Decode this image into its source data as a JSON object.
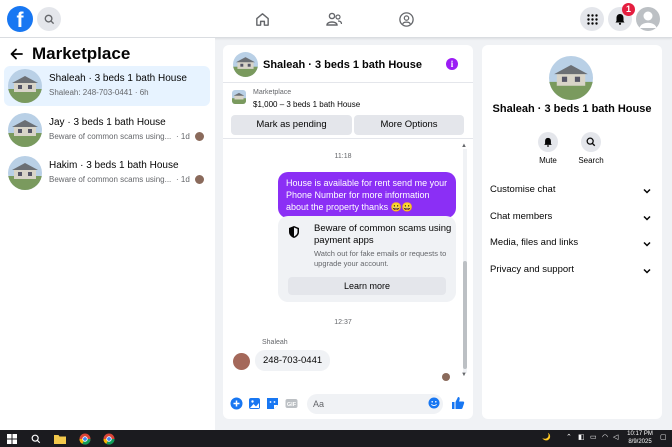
{
  "topbar": {
    "logo_letter": "f",
    "notification_count": "1",
    "brand_color": "#1877f2"
  },
  "sidebar": {
    "title": "Marketplace",
    "conversations": [
      {
        "name": "Shaleah · 3 beds 1 bath House",
        "preview": "Shaleah: 248-703-0441 · 6h",
        "time": "",
        "active": true
      },
      {
        "name": "Jay · 3 beds 1 bath House",
        "preview": "Beware of common scams using...",
        "time": "· 1d",
        "active": false
      },
      {
        "name": "Hakim · 3 beds 1 bath House",
        "preview": "Beware of common scams using...",
        "time": "· 1d",
        "active": false
      }
    ]
  },
  "chat": {
    "title": "Shaleah · 3 beds 1 bath House",
    "listing": {
      "source": "Marketplace",
      "price_line": "$1,000 – 3 beds 1 bath House",
      "pending_label": "Mark as pending",
      "options_label": "More Options"
    },
    "time_1": "11:18",
    "outgoing_message": "House is available for rent send me your Phone Number for more information about the property thanks 😀😀",
    "warning": {
      "title": "Beware of common scams using payment apps",
      "body": "Watch out for fake emails or requests to upgrade your account.",
      "button": "Learn more"
    },
    "time_2": "12:37",
    "sender_name": "Shaleah",
    "incoming_message": "248-703-0441",
    "input_placeholder": "Aa",
    "accent_color": "#8b2ff5"
  },
  "details": {
    "name": "Shaleah · 3 beds 1 bath House",
    "actions": [
      {
        "label": "Mute",
        "icon": "bell-icon"
      },
      {
        "label": "Search",
        "icon": "search-icon"
      }
    ],
    "sections": [
      "Customise chat",
      "Chat members",
      "Media, files and links",
      "Privacy and support"
    ]
  },
  "taskbar": {
    "time": "10:17 PM",
    "date": "8/9/2025"
  }
}
